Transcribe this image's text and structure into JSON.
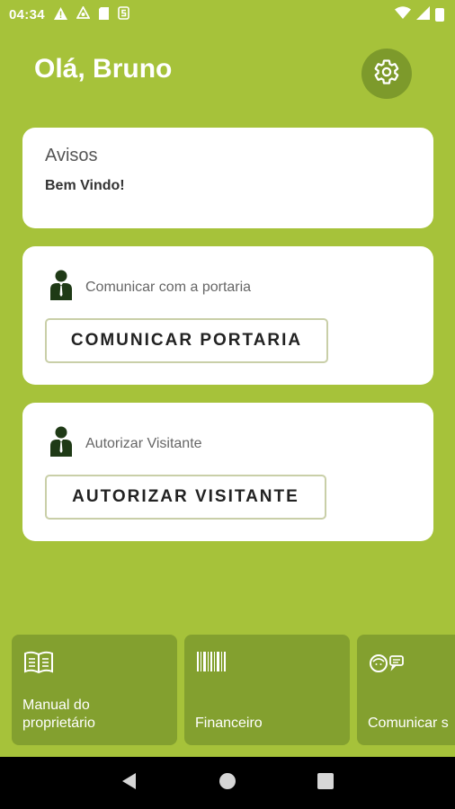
{
  "status_bar": {
    "time": "04:34",
    "notification_icons": [
      "warning-icon",
      "sync-icon",
      "sim-card-icon",
      "s-icon"
    ],
    "system_icons": [
      "wifi-icon",
      "signal-icon",
      "battery-icon"
    ]
  },
  "header": {
    "greeting": "Olá, Bruno",
    "settings_icon": "gear-icon"
  },
  "notices": {
    "title": "Avisos",
    "message": "Bem Vindo!"
  },
  "actions": [
    {
      "label": "Comunicar com a portaria",
      "button": "COMUNICAR PORTARIA",
      "icon": "person-icon"
    },
    {
      "label": "Autorizar Visitante",
      "button": "AUTORIZAR VISITANTE",
      "icon": "person-icon"
    }
  ],
  "tiles": [
    {
      "label": "Manual do\nproprietário",
      "icon": "book-icon"
    },
    {
      "label": "Financeiro",
      "icon": "barcode-icon"
    },
    {
      "label": "Comunicar s",
      "icon": "chat-icon"
    }
  ],
  "nav": [
    "back-icon",
    "home-icon",
    "recents-icon"
  ],
  "colors": {
    "background": "#a6c23a",
    "tile": "#83a02f",
    "settings_button": "#7d9a2b",
    "card": "#ffffff"
  }
}
